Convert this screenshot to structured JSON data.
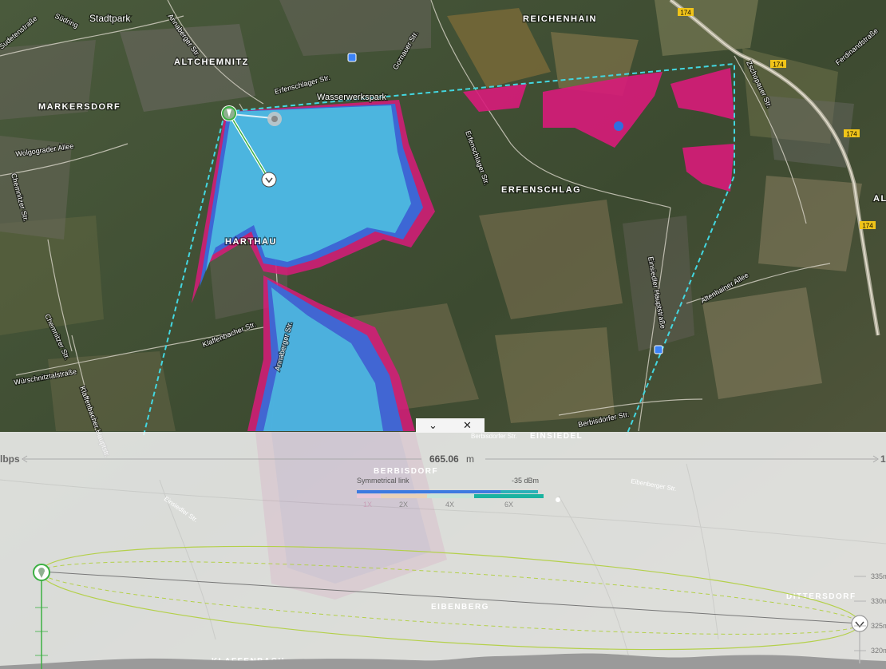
{
  "map": {
    "places": [
      "Stadtpark",
      "ALTCHEMNITZ",
      "MARKERSDORF",
      "REICHENHAIN",
      "ERFENSCHLAG",
      "HARTHAU",
      "EINSIEDEL",
      "EIBENBERG",
      "KLAFFENBACH",
      "DITTERSDORF",
      "Wasserwerkspark",
      "ALI"
    ],
    "streets": [
      "Südring",
      "Sudetenstraße",
      "Annaberger Str.",
      "Gornauer Str.",
      "Erfenschlager Str.",
      "Zschopauer Str.",
      "Ferdinandstraße",
      "Wolgograder Allee",
      "Chemnitzer Str.",
      "Klaffenbacher Str.",
      "Würschnitztalstraße",
      "Klaffenbacher Hauptstr.",
      "Einsiedler Hauptstraße",
      "Altenhainer Allee",
      "Berbisdorfer Str.",
      "Eibenberger Str.",
      "Einsiedler Str.",
      "Annaberger Str."
    ],
    "road_shield": "174",
    "colors": {
      "coverage_cyan": "#4fc3e0",
      "coverage_blue": "#2f6fe0",
      "coverage_magenta": "#d81b7a",
      "sector_outline": "#43d7e0",
      "link_green": "#3cb043"
    }
  },
  "panel": {
    "tabs": {
      "collapse_icon": "chevron-down-icon",
      "close_icon": "close-icon",
      "collapse": "⌄",
      "close": "✕"
    },
    "distance": {
      "value": "665.06",
      "unit": "m",
      "left_edge": "lbps",
      "right_edge": "1"
    },
    "legend": {
      "title": "Symmetrical link",
      "signal": "-35  dBm",
      "ticks": [
        "1X",
        "2X",
        "4X",
        "6X"
      ]
    },
    "altitudes": [
      "335m",
      "330m",
      "325m",
      "320m"
    ]
  }
}
